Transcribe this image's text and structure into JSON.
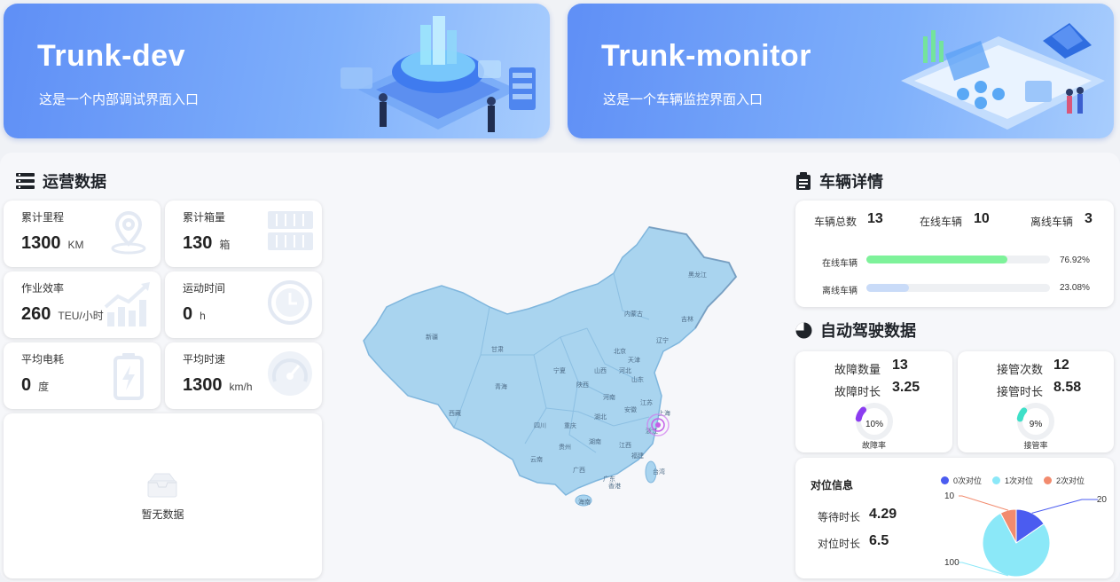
{
  "banners": [
    {
      "title": "Trunk-dev",
      "subtitle": "这是一个内部调试界面入口"
    },
    {
      "title": "Trunk-monitor",
      "subtitle": "这是一个车辆监控界面入口"
    }
  ],
  "operations": {
    "title": "运营数据",
    "stats": [
      {
        "label": "累计里程",
        "value": "1300",
        "unit": "KM",
        "icon": "location-pin-icon"
      },
      {
        "label": "累计箱量",
        "value": "130",
        "unit": "箱",
        "icon": "container-icon"
      },
      {
        "label": "作业效率",
        "value": "260",
        "unit": "TEU/小时",
        "icon": "trend-chart-icon"
      },
      {
        "label": "运动时间",
        "value": "0",
        "unit": "h",
        "icon": "clock-icon"
      },
      {
        "label": "平均电耗",
        "value": "0",
        "unit": "度",
        "icon": "battery-icon"
      },
      {
        "label": "平均时速",
        "value": "1300",
        "unit": "km/h",
        "icon": "speedometer-icon"
      }
    ],
    "empty_text": "暂无数据"
  },
  "map": {
    "provinces": [
      "新疆",
      "西藏",
      "青海",
      "甘肃",
      "内蒙古",
      "黑龙江",
      "吉林",
      "辽宁",
      "山西",
      "河北",
      "北京",
      "天津",
      "山东",
      "河南",
      "陕西",
      "宁夏",
      "四川",
      "重庆",
      "湖北",
      "安徽",
      "江苏",
      "上海",
      "浙江",
      "湖南",
      "江西",
      "贵州",
      "云南",
      "广西",
      "广东",
      "福建",
      "台湾",
      "海南",
      "香港"
    ],
    "highlight_color": "#c55fe8"
  },
  "vehicle": {
    "title": "车辆详情",
    "total_label": "车辆总数",
    "total": "13",
    "online_label": "在线车辆",
    "online": "10",
    "offline_label": "离线车辆",
    "offline": "3",
    "bars": [
      {
        "label": "在线车辆",
        "percent_text": "76.92%",
        "percent": 76.92,
        "color": "#7ef29a"
      },
      {
        "label": "离线车辆",
        "percent_text": "23.08%",
        "percent": 23.08,
        "color": "#c9dbf8"
      }
    ]
  },
  "autopilot": {
    "title": "自动驾驶数据",
    "fault": {
      "count_label": "故障数量",
      "count": "13",
      "duration_label": "故障时长",
      "duration": "3.25",
      "rate_text": "10%",
      "rate": 10,
      "rate_label": "故障率",
      "color": "#8b3cf0"
    },
    "takeover": {
      "count_label": "接管次数",
      "count": "12",
      "duration_label": "接管时长",
      "duration": "8.58",
      "rate_text": "9%",
      "rate": 9,
      "rate_label": "接管率",
      "color": "#3ee0c8"
    }
  },
  "alignment": {
    "title": "对位信息",
    "wait_label": "等待时长",
    "wait": "4.29",
    "align_label": "对位时长",
    "align": "6.5",
    "chart_data": {
      "type": "pie",
      "series": [
        {
          "name": "0次对位",
          "value": 20,
          "color": "#4b5cf0"
        },
        {
          "name": "1次对位",
          "value": 100,
          "color": "#8be8f8"
        },
        {
          "name": "2次对位",
          "value": 10,
          "color": "#f28b6e"
        }
      ],
      "legend": "top"
    }
  }
}
